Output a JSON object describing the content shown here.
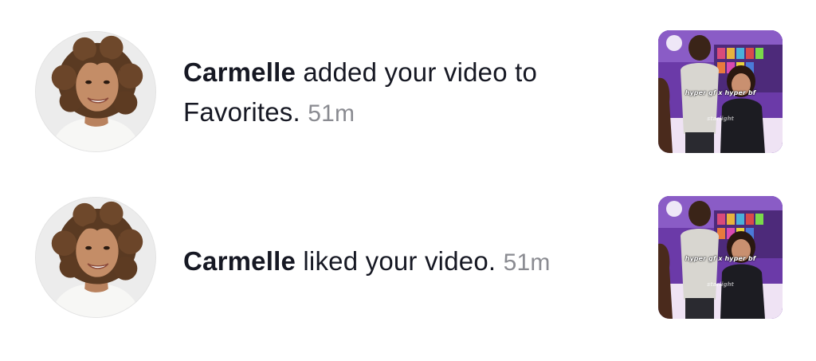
{
  "notifications": [
    {
      "username": "Carmelle",
      "action": " added your video to Favorites.",
      "time": "51m",
      "thumbnail_caption": "hyper gf x hyper bf",
      "thumbnail_watermark": "starlight"
    },
    {
      "username": "Carmelle",
      "action": " liked your video.",
      "time": "51m",
      "thumbnail_caption": "hyper gf x hyper bf",
      "thumbnail_watermark": "starlight"
    }
  ],
  "colors": {
    "text_primary": "#161823",
    "text_secondary": "#8a8b91",
    "background": "#ffffff",
    "thumbnail_bg": "#6d3bb0"
  }
}
